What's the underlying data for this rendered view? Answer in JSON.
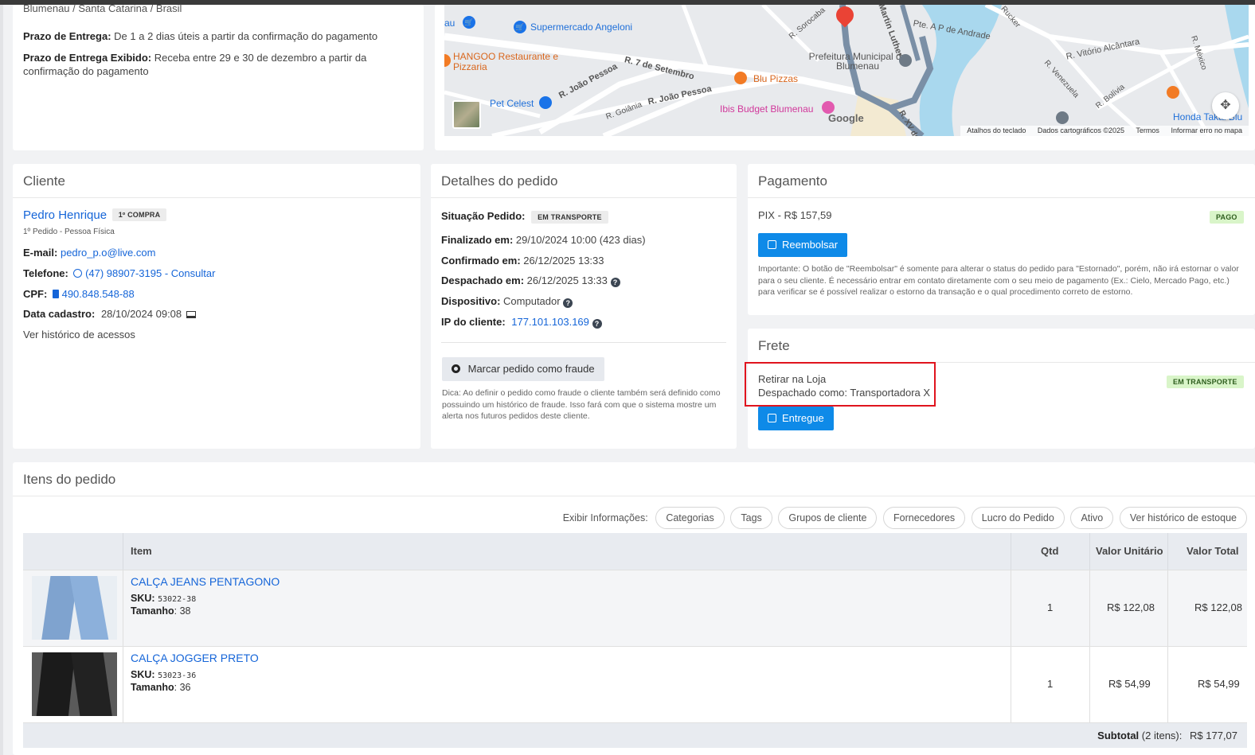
{
  "top_left": {
    "location": "Blumenau / Santa Catarina / Brasil",
    "prazo_label": "Prazo de Entrega:",
    "prazo_value": "De 1 a 2 dias úteis a partir da confirmação do pagamento",
    "prazo_exibido_label": "Prazo de Entrega Exibido:",
    "prazo_exibido_value": "Receba entre 29 e 30 de dezembro a partir da confirmação do pagamento"
  },
  "map": {
    "labels": {
      "supermercado": "Supermercado Angeloni",
      "hangoo": "HANGOO Restaurante e Pizzaria",
      "prefeitura": "Prefeitura Municipal de Blumenau",
      "blu_pizzas": "Blu Pizzas",
      "ibis": "Ibis Budget Blumenau",
      "pet_celest": "Pet Celest",
      "honda": "Honda Takai Blu",
      "street_7set": "R. 7 de Setembro",
      "street_joao": "R. João Pessoa",
      "street_joao2": "R. João Pessoa",
      "street_goiania": "R. Goiânia",
      "street_andrade": "Pte. A P de Andrade",
      "street_alcantara": "R. Vitório Alcântara",
      "street_venezuela": "R. Venezuela",
      "street_bolivia": "R. Bolívia",
      "street_mexico": "R. México",
      "street_xv": "R. XV de",
      "street_luther": "Martin Luther",
      "street_sorocaba": "R. Sorocaba",
      "street_rucker": "Rucker",
      "google": "Google",
      "au": "au"
    },
    "footer": {
      "atalhos": "Atalhos do teclado",
      "dados": "Dados cartográficos ©2025",
      "termos": "Termos",
      "erro": "Informar erro no mapa"
    }
  },
  "cliente": {
    "title": "Cliente",
    "name": "Pedro Henrique",
    "badge": "1º COMPRA",
    "subtitle": "1º Pedido - Pessoa Física",
    "email_label": "E-mail:",
    "email": "pedro_p.o@live.com",
    "telefone_label": "Telefone:",
    "telefone": "(47) 98907-3195 - Consultar",
    "cpf_label": "CPF:",
    "cpf": "490.848.548-88",
    "cadastro_label": "Data cadastro:",
    "cadastro": "28/10/2024 09:08",
    "historico": "Ver histórico de acessos"
  },
  "detalhes": {
    "title": "Detalhes do pedido",
    "situacao_label": "Situação Pedido:",
    "situacao": "EM TRANSPORTE",
    "finalizado_label": "Finalizado em:",
    "finalizado": "29/10/2024 10:00 (423 dias)",
    "confirmado_label": "Confirmado em:",
    "confirmado": "26/12/2025 13:33",
    "despachado_label": "Despachado em:",
    "despachado": "26/12/2025 13:33",
    "dispositivo_label": "Dispositivo:",
    "dispositivo": "Computador",
    "ip_label": "IP do cliente:",
    "ip": "177.101.103.169",
    "fraude_button": "Marcar pedido como fraude",
    "dica": "Dica: Ao definir o pedido como fraude o cliente também será definido como possuindo um histórico de fraude. Isso fará com que o sistema mostre um alerta nos futuros pedidos deste cliente."
  },
  "pagamento": {
    "title": "Pagamento",
    "method": "PIX - R$ 157,59",
    "status": "PAGO",
    "button": "Reembolsar",
    "note": "Importante: O botão de \"Reembolsar\" é somente para alterar o status do pedido para \"Estornado\", porém, não irá estornar o valor para o seu cliente. É necessário entrar em contato diretamente com o seu meio de pagamento (Ex.: Cielo, Mercado Pago, etc.) para verificar se é possível realizar o estorno da transação e o qual procedimento correto de estorno."
  },
  "frete": {
    "title": "Frete",
    "line1": "Retirar na Loja",
    "line2": "Despachado como: Transportadora X",
    "status": "EM TRANSPORTE",
    "button": "Entregue"
  },
  "itens": {
    "title": "Itens do pedido",
    "exibir_label": "Exibir Informações:",
    "filters": [
      "Categorias",
      "Tags",
      "Grupos de cliente",
      "Fornecedores",
      "Lucro do Pedido",
      "Ativo",
      "Ver histórico de estoque"
    ],
    "columns": {
      "item": "Item",
      "qtd": "Qtd",
      "unit": "Valor Unitário",
      "total": "Valor Total"
    },
    "sku_label": "SKU",
    "tamanho_label": "Tamanho",
    "rows": [
      {
        "name": "CALÇA JEANS PENTAGONO",
        "sku": "53022-38",
        "tamanho": "38",
        "qtd": "1",
        "unit": "R$ 122,08",
        "total": "R$ 122,08"
      },
      {
        "name": "CALÇA JOGGER PRETO",
        "sku": "53023-36",
        "tamanho": "36",
        "qtd": "1",
        "unit": "R$ 54,99",
        "total": "R$ 54,99"
      }
    ],
    "subtotal_label": "Subtotal",
    "subtotal_count": "(2 itens):",
    "subtotal_value": "R$ 177,07"
  },
  "colors": {
    "link": "#1565d8",
    "primary_button": "#0e8ae8",
    "highlight_box": "#e0141e",
    "badge_green": "#d9f5c9",
    "water": "#a9d8ee"
  }
}
